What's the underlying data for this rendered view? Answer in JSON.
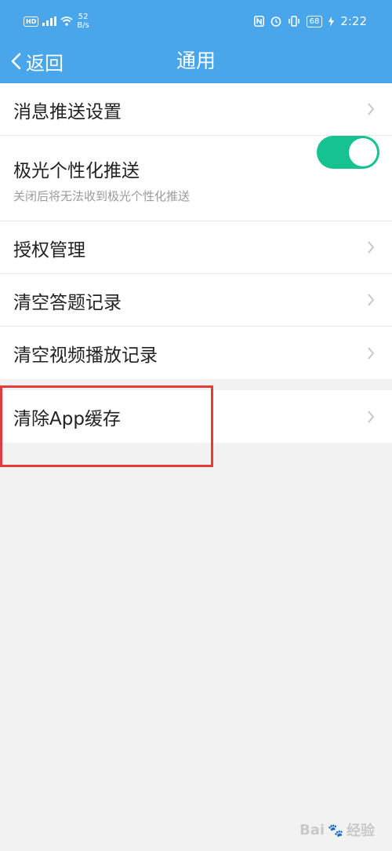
{
  "status_bar": {
    "hd": "HD",
    "net_speed_value": "52",
    "net_speed_unit": "B/s",
    "battery": "68",
    "time": "2:22"
  },
  "nav": {
    "back_label": "返回",
    "title": "通用"
  },
  "rows": {
    "push_settings": "消息推送设置",
    "jpush_personal": "极光个性化推送",
    "jpush_personal_desc": "关闭后将无法收到极光个性化推送",
    "jpush_enabled": true,
    "auth_manage": "授权管理",
    "clear_answer_records": "清空答题记录",
    "clear_video_records": "清空视频播放记录",
    "clear_app_cache": "清除App缓存"
  },
  "colors": {
    "header": "#4aa6ea",
    "toggle_on": "#16c28f",
    "highlight": "#e53b3b"
  },
  "icons": {
    "back": "chevron-left-icon",
    "row_arrow": "chevron-right-icon"
  },
  "watermark": {
    "brand": "Bai",
    "suffix": "经验"
  }
}
